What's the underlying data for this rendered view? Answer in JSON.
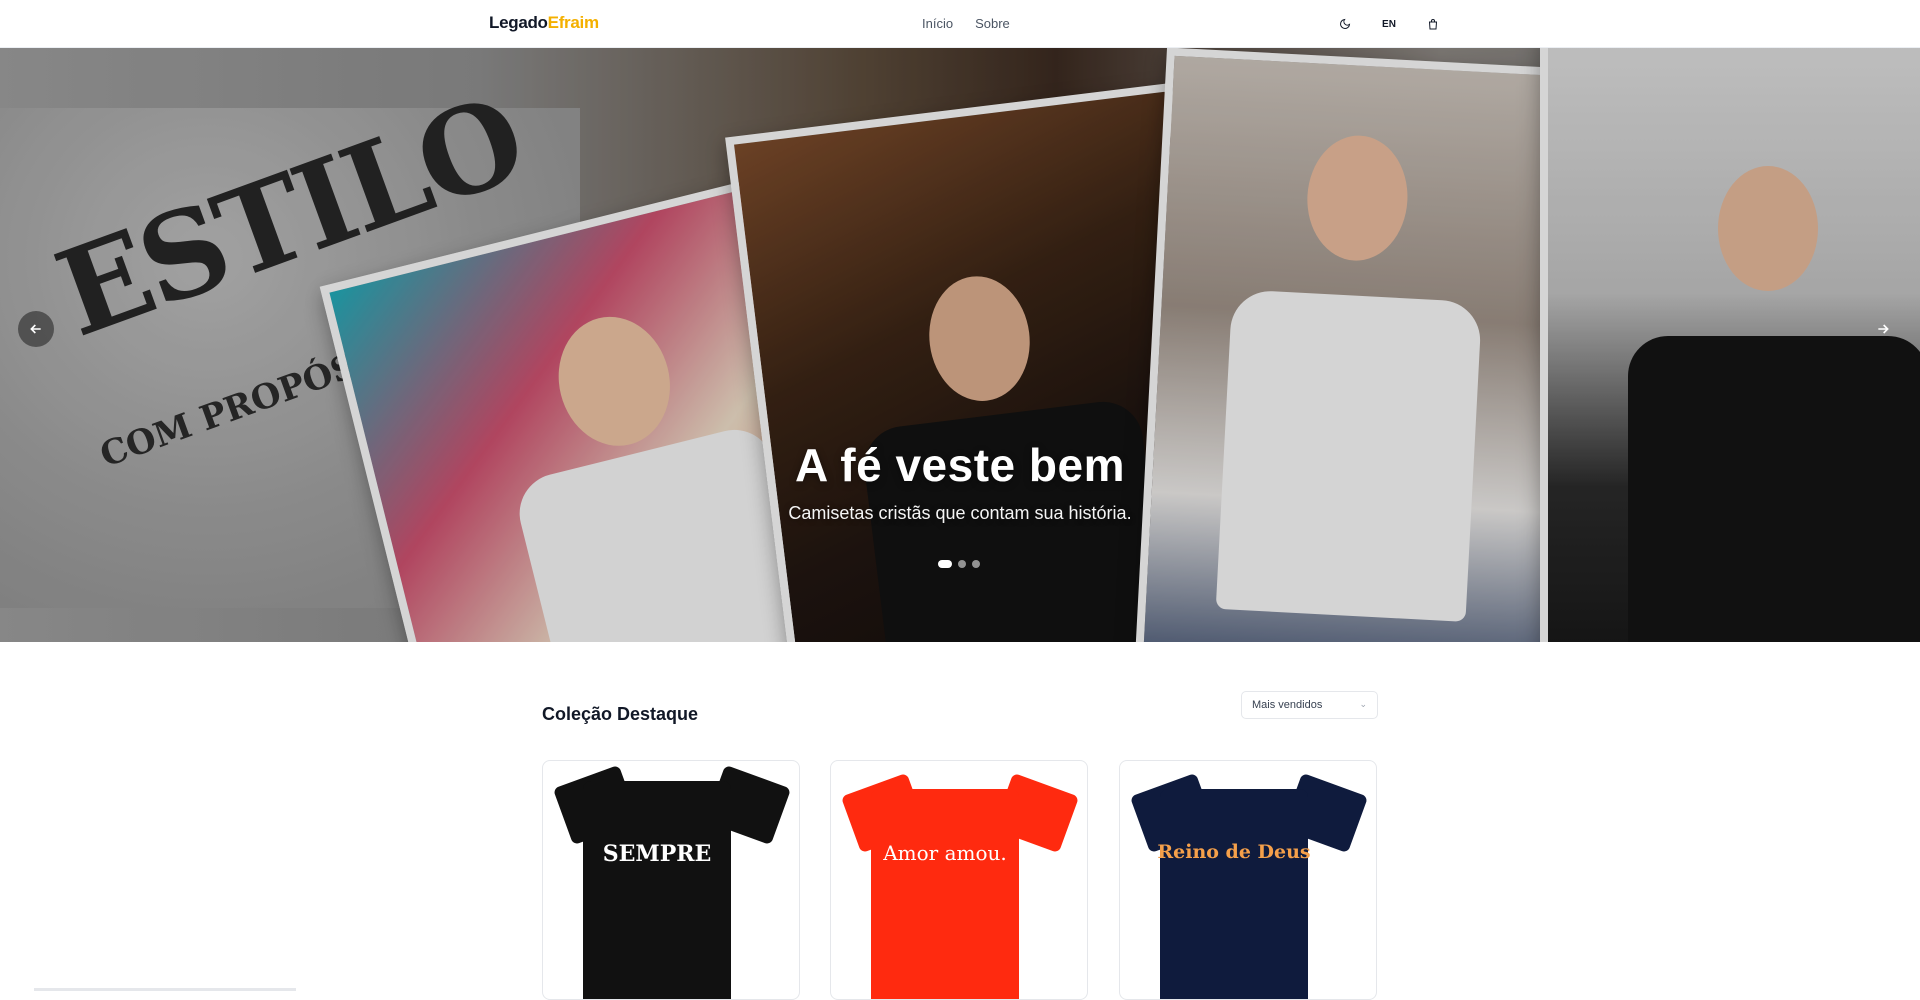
{
  "header": {
    "logo_part1": "Legado",
    "logo_part2": "Efraim",
    "nav": [
      "Início",
      "Sobre"
    ],
    "lang": "EN",
    "icons": [
      "moon-icon",
      "cart-icon"
    ]
  },
  "hero": {
    "title": "A fé veste bem",
    "subtitle": "Camisetas cristãs que contam sua história.",
    "stamp_line1": "ESTILO",
    "stamp_line2": "COM PROPÓSITO",
    "active_slide": 1,
    "slide_count": 3
  },
  "collection": {
    "title": "Coleção Destaque",
    "sort_value": "Mais vendidos",
    "products": [
      {
        "color": "#111111",
        "art": "SEMPRE"
      },
      {
        "color": "#ff2a0f",
        "art": "Amor amou."
      },
      {
        "color": "#0f1b3d",
        "art": "Reino de Deus"
      }
    ]
  },
  "colors": {
    "accent": "#f4b000",
    "text": "#111827"
  }
}
